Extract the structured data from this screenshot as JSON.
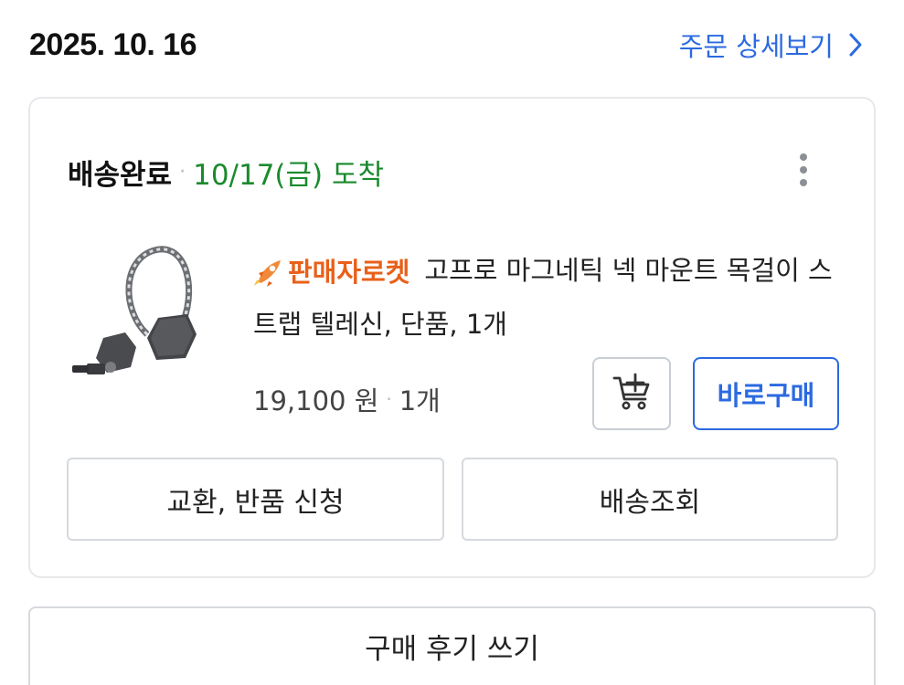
{
  "order": {
    "date": "2025. 10. 16",
    "detail_link": "주문 상세보기",
    "status": "배송완료",
    "arrival": "10/17(금) 도착",
    "product": {
      "badge": "판매자로켓",
      "title": "고프로 마그네틱 넥 마운트 목걸이 스트랩 텔레신, 단품, 1개",
      "price": "19,100 원",
      "quantity": "1개",
      "image_icon": "neck-mount-strap-product-image"
    },
    "buttons": {
      "buy_now": "바로구매",
      "exchange_return": "교환, 반품 신청",
      "tracking": "배송조회",
      "review": "구매 후기 쓰기"
    },
    "colors": {
      "link_blue": "#2b6ae0",
      "arrival_green": "#1a8a2e",
      "badge_orange": "#e8601a"
    }
  }
}
